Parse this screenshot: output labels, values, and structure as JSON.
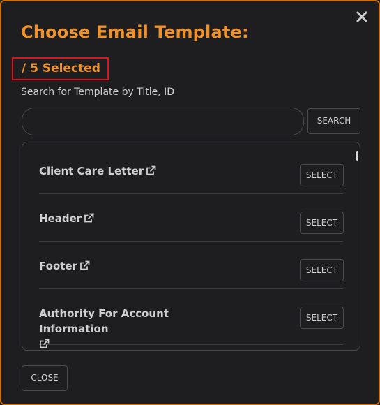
{
  "dialog": {
    "title": "Choose Email Template:",
    "selected_count": "/ 5 Selected",
    "search_label": "Search for Template by Title, ID",
    "search_value": "",
    "search_button": "SEARCH",
    "close_button": "CLOSE"
  },
  "templates": [
    {
      "title": "Client Care Letter",
      "action": "SELECT"
    },
    {
      "title": "Header",
      "action": "SELECT"
    },
    {
      "title": "Footer",
      "action": "SELECT"
    },
    {
      "title": "Authority For Account Information",
      "action": "SELECT"
    }
  ],
  "colors": {
    "accent": "#f0922b",
    "border": "#c6701c",
    "highlight": "#e0141e",
    "background": "#1e1e21"
  },
  "icons": {
    "close": "close-icon",
    "external": "external-link-icon"
  }
}
